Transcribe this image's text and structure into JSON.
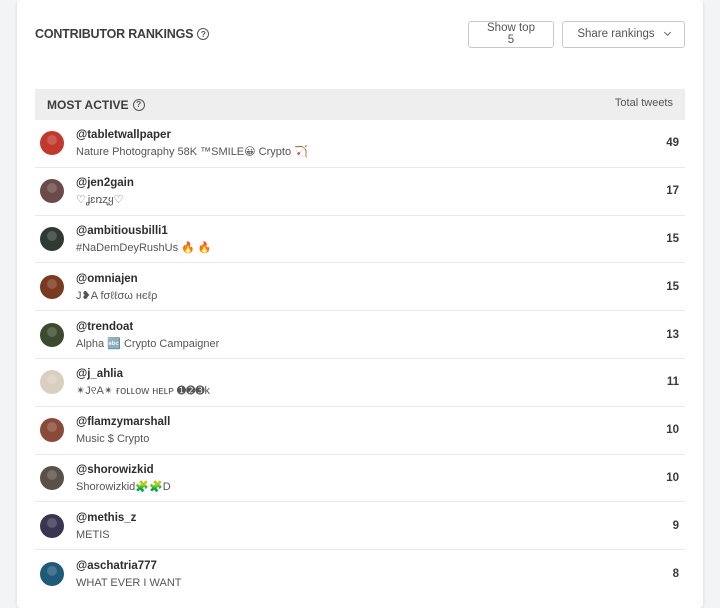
{
  "header": {
    "title": "CONTRIBUTOR RANKINGS",
    "show_top_label": "Show top 5",
    "share_label": "Share rankings"
  },
  "table": {
    "section_title": "MOST ACTIVE",
    "count_header": "Total tweets",
    "rows": [
      {
        "handle": "@tabletwallpaper",
        "bio": "Nature Photography 58K ™SMILE😀 Crypto 🏹",
        "count": "49",
        "avatar_color": "#c0392b"
      },
      {
        "handle": "@jen2gain",
        "bio": "♡ʝɛռʐყ♡",
        "count": "17",
        "avatar_color": "#6b4a4a"
      },
      {
        "handle": "@ambitiousbilli1",
        "bio": "#NaDemDeyRushUs 🔥 🔥",
        "count": "15",
        "avatar_color": "#2f3a33"
      },
      {
        "handle": "@omniajen",
        "bio": "J❥A fσℓℓσω нєℓρ",
        "count": "15",
        "avatar_color": "#7a3a20"
      },
      {
        "handle": "@trendoat",
        "bio": "Alpha 🔤 Crypto Campaigner",
        "count": "13",
        "avatar_color": "#3c4a2e"
      },
      {
        "handle": "@j_ahlia",
        "bio": "✴J୧A✴ ғᴏʟʟᴏᴡ ʜᴇʟᴘ ➊➋➌k",
        "count": "11",
        "avatar_color": "#d8cfc0"
      },
      {
        "handle": "@flamzymarshall",
        "bio": "Music $ Crypto",
        "count": "10",
        "avatar_color": "#8a4a3a"
      },
      {
        "handle": "@shorowizkid",
        "bio": "Shorowizkid🧩🧩D",
        "count": "10",
        "avatar_color": "#5a5047"
      },
      {
        "handle": "@methis_z",
        "bio": "METIS",
        "count": "9",
        "avatar_color": "#3a3550"
      },
      {
        "handle": "@aschatria777",
        "bio": "WHAT EVER I WANT",
        "count": "8",
        "avatar_color": "#1f5a7a"
      }
    ]
  }
}
